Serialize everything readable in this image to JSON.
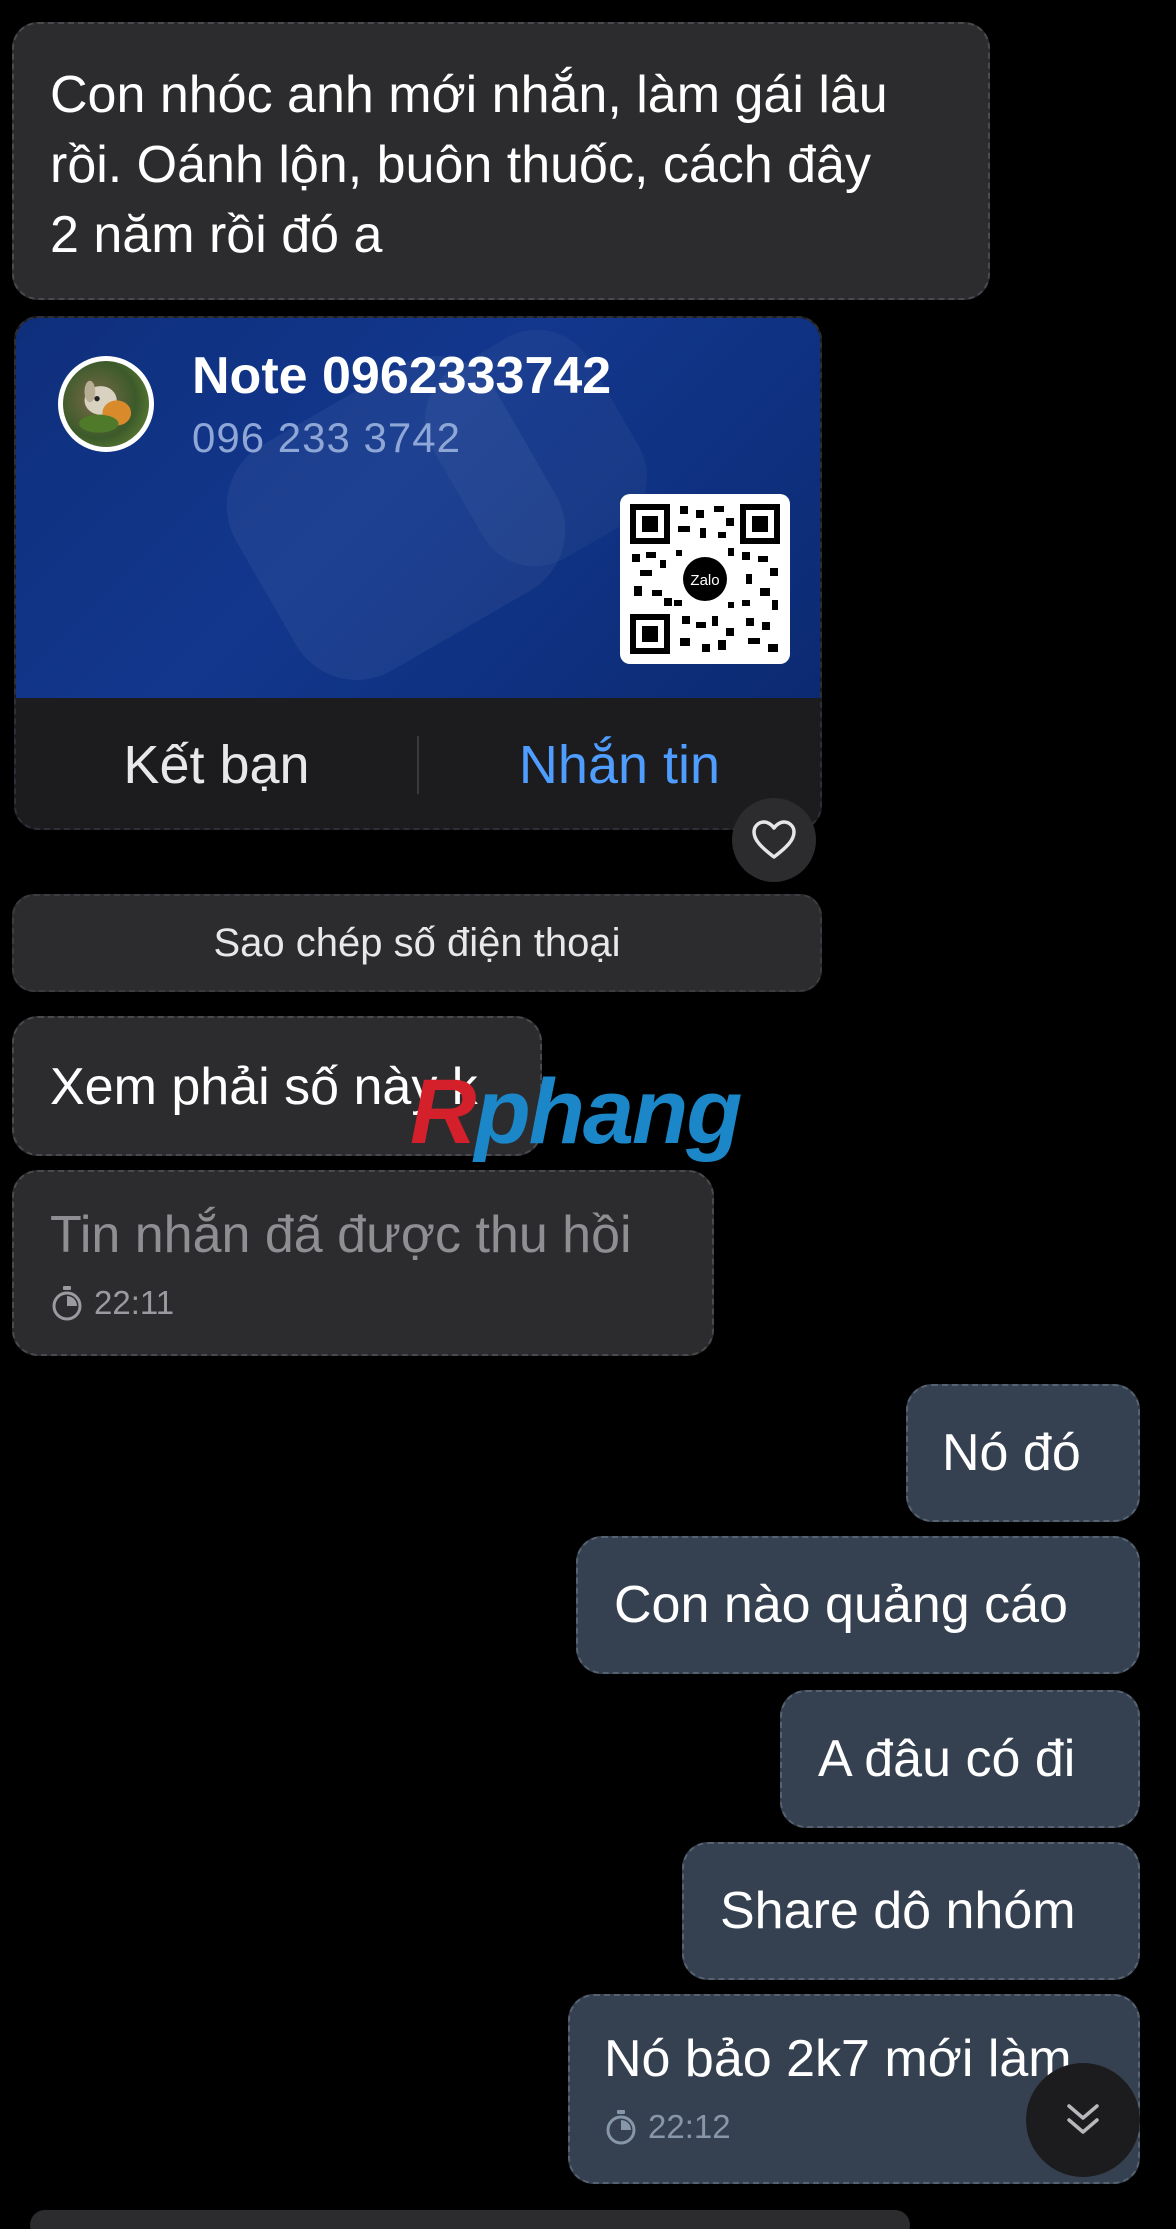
{
  "messages_in": [
    {
      "text": "Con nhóc anh mới nhắn, làm gái lâu\nrồi. Oánh lộn, buôn thuốc, cách đây\n2 năm rồi đó a"
    }
  ],
  "contact_card": {
    "name": "Note 0962333742",
    "phone": "096 233 3742",
    "qr_logo": "Zalo",
    "add_friend_label": "Kết bạn",
    "message_label": "Nhắn tin"
  },
  "reaction": {
    "icon": "heart-icon"
  },
  "copy_phone_label": "Sao chép số điện thoại",
  "incoming2": {
    "text": "Xem phải số này k"
  },
  "recalled": {
    "text": "Tin nhắn đã được thu hồi",
    "time": "22:11"
  },
  "messages_out": [
    {
      "text": "Nó đó"
    },
    {
      "text": "Con nào quảng cáo"
    },
    {
      "text": "A đâu có đi"
    },
    {
      "text": "Share dô nhóm"
    },
    {
      "text": "Nó bảo 2k7 mới làm",
      "time": "22:12"
    }
  ],
  "watermark": {
    "part1": "R",
    "part2": "phang"
  },
  "scroll_button": {
    "icon": "chevron-double-down-icon"
  },
  "colors": {
    "background": "#000000",
    "incoming_bubble": "#2c2c2e",
    "outgoing_bubble": "#354150",
    "card_blue": "#12378d",
    "accent_link": "#4f9dff"
  }
}
